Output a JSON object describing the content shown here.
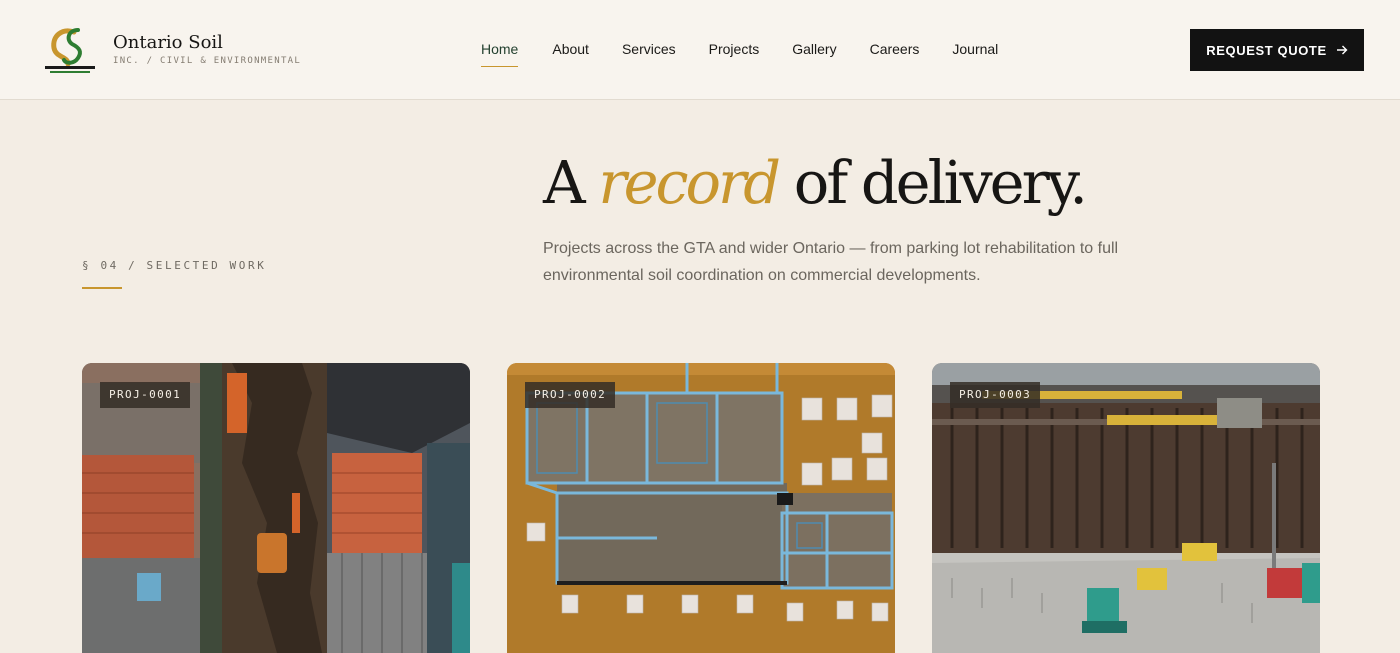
{
  "brand": {
    "name": "Ontario Soil",
    "subtitle": "INC. / CIVIL & ENVIRONMENTAL",
    "logo_text": "Ontario Soil Inc",
    "logo_subtext": "GC and Environmental",
    "colors": {
      "gold": "#c8962e",
      "green": "#2e7d32"
    }
  },
  "scroll_progress": 0.6,
  "nav": {
    "items": [
      {
        "label": "Home",
        "active": true
      },
      {
        "label": "About"
      },
      {
        "label": "Services"
      },
      {
        "label": "Projects"
      },
      {
        "label": "Gallery"
      },
      {
        "label": "Careers"
      },
      {
        "label": "Journal"
      }
    ],
    "cta_label": "REQUEST QUOTE",
    "cta_icon": "arrow-right-icon"
  },
  "section": {
    "eyebrow": "§ 04 / SELECTED WORK",
    "title_start": "A",
    "title_emphasis": "record",
    "title_end": "of delivery.",
    "description": "Projects across the GTA and wider Ontario — from parking lot rehabilitation to full environmental soil coordination on commercial developments."
  },
  "projects": [
    {
      "id": "PROJ-0001",
      "image": "aerial-trench-between-buildings"
    },
    {
      "id": "PROJ-0002",
      "image": "aerial-foundation-formwork"
    },
    {
      "id": "PROJ-0003",
      "image": "shoring-wall-excavation-site"
    }
  ],
  "accent_color": "#c8962e",
  "cta_color": "#121212"
}
